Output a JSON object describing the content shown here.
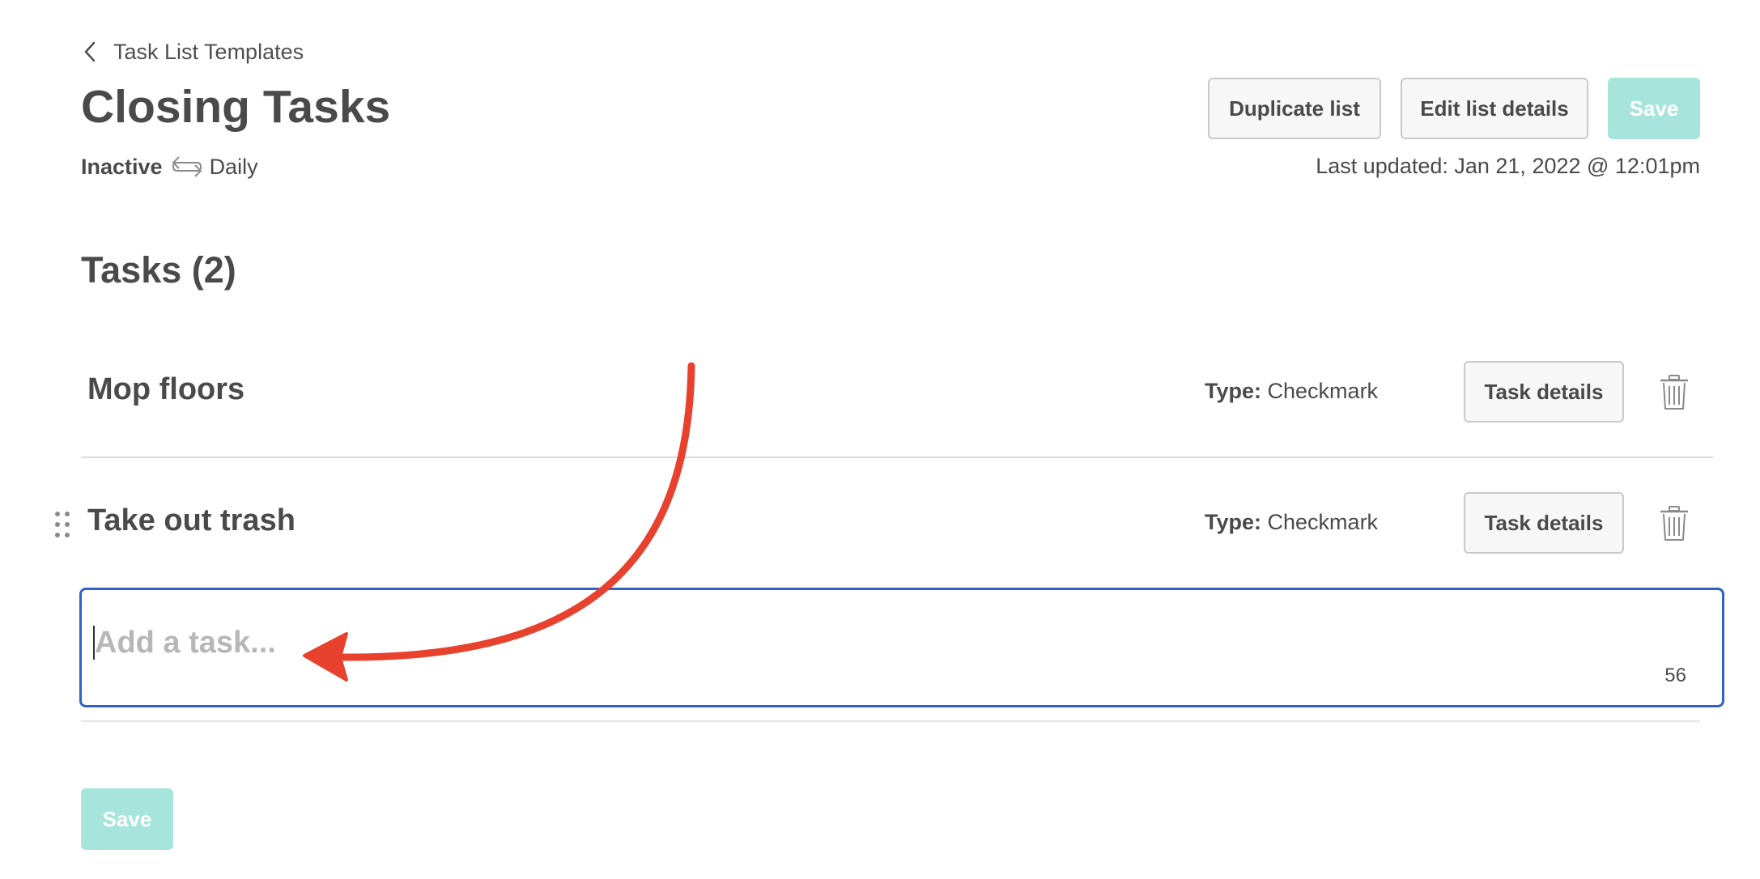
{
  "breadcrumb": {
    "label": "Task List Templates"
  },
  "page": {
    "title": "Closing Tasks",
    "status": "Inactive",
    "frequency": "Daily",
    "last_updated": "Last updated: Jan 21, 2022 @ 12:01pm"
  },
  "toolbar": {
    "duplicate_label": "Duplicate list",
    "edit_label": "Edit list details",
    "save_label": "Save"
  },
  "tasks": {
    "heading": "Tasks (2)",
    "type_label": "Type:",
    "items": [
      {
        "name": "Mop floors",
        "type": "Checkmark",
        "details_label": "Task details"
      },
      {
        "name": "Take out trash",
        "type": "Checkmark",
        "details_label": "Task details"
      }
    ]
  },
  "add_task": {
    "placeholder": "Add a task...",
    "char_count": "56"
  },
  "footer": {
    "save_label": "Save"
  },
  "colors": {
    "accent_disabled": "#a6e4dc",
    "focus_border": "#2f63c4",
    "annotation_arrow": "#e8412e"
  },
  "icons": [
    "chevron-left-icon",
    "repeat-icon",
    "trash-icon",
    "drag-handle-icon"
  ]
}
